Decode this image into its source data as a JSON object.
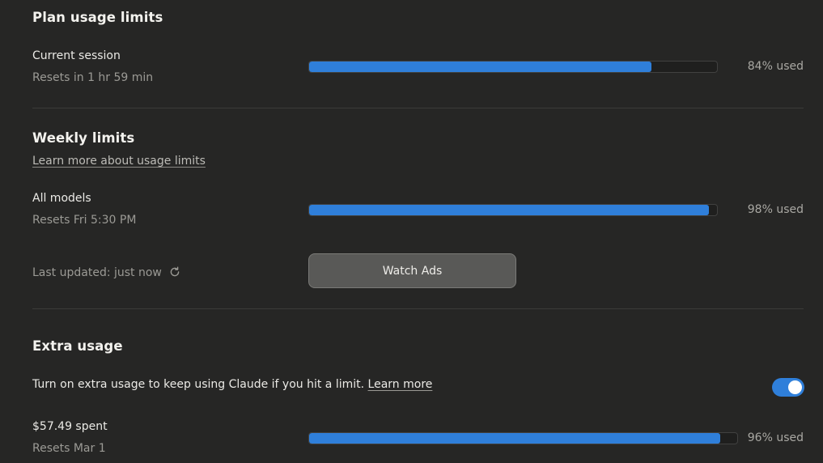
{
  "plan": {
    "title": "Plan usage limits",
    "current_session": {
      "label": "Current session",
      "reset_text": "Resets in 1 hr 59 min",
      "percent_text": "84% used",
      "fraction": 0.84
    }
  },
  "weekly": {
    "title": "Weekly limits",
    "learn_more": "Learn more about usage limits",
    "all_models": {
      "label": "All models",
      "reset_text": "Resets Fri 5:30 PM",
      "percent_text": "98% used",
      "fraction": 0.98
    },
    "last_updated": "Last updated: just now",
    "refresh_icon": "refresh-icon",
    "watch_ads_label": "Watch Ads"
  },
  "extra": {
    "title": "Extra usage",
    "description": "Turn on extra usage to keep using Claude if you hit a limit.",
    "learn_more": "Learn more",
    "toggle_on": true,
    "spent": {
      "label": "$57.49 spent",
      "reset_text": "Resets Mar 1",
      "percent_text": "96% used",
      "fraction": 0.96
    }
  },
  "colors": {
    "background": "#262625",
    "accent": "#2f7fda",
    "button": "#595957"
  }
}
